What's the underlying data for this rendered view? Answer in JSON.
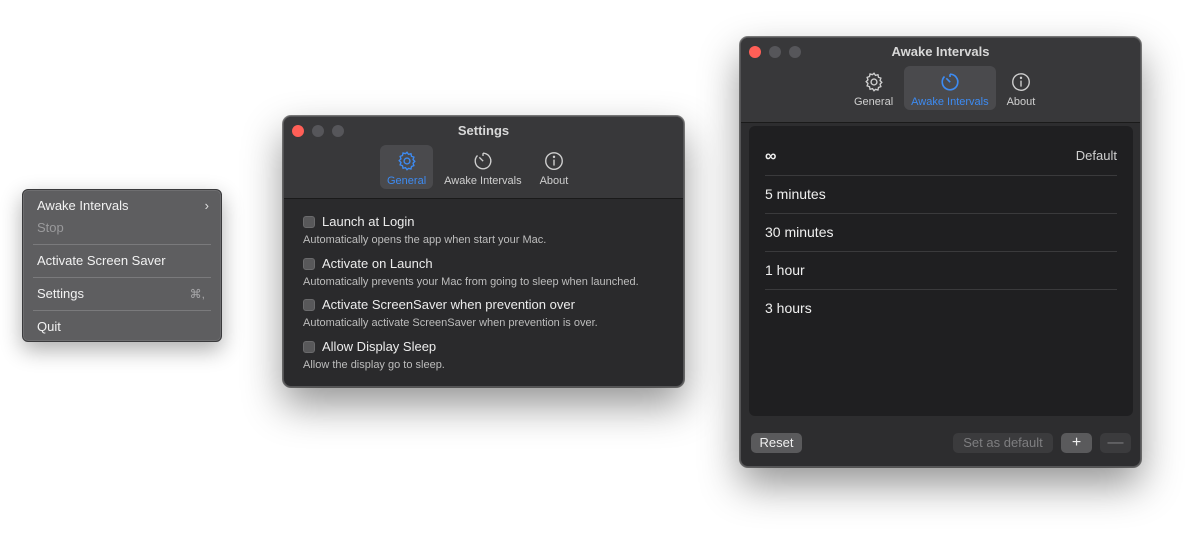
{
  "menu": {
    "items": [
      {
        "label": "Awake Intervals",
        "submenu": true
      },
      {
        "label": "Stop",
        "disabled": true
      },
      {
        "label": "Activate Screen Saver"
      },
      {
        "label": "Settings",
        "shortcut": "⌘,"
      },
      {
        "label": "Quit"
      }
    ]
  },
  "settings_window": {
    "title": "Settings",
    "tabs": [
      {
        "label": "General",
        "icon": "gear-icon",
        "active": true
      },
      {
        "label": "Awake Intervals",
        "icon": "timer-icon"
      },
      {
        "label": "About",
        "icon": "info-icon"
      }
    ],
    "options": [
      {
        "title": "Launch at Login",
        "description": "Automatically opens the app when start your Mac.",
        "checked": false
      },
      {
        "title": "Activate on Launch",
        "description": "Automatically prevents your Mac from going to sleep when launched.",
        "checked": false
      },
      {
        "title": "Activate ScreenSaver when prevention over",
        "description": "Automatically activate ScreenSaver when prevention is over.",
        "checked": false
      },
      {
        "title": "Allow Display Sleep",
        "description": "Allow the display go to sleep.",
        "checked": false
      }
    ]
  },
  "awake_window": {
    "title": "Awake Intervals",
    "tabs": [
      {
        "label": "General",
        "icon": "gear-icon"
      },
      {
        "label": "Awake Intervals",
        "icon": "timer-icon",
        "active": true
      },
      {
        "label": "About",
        "icon": "info-icon"
      }
    ],
    "intervals": [
      {
        "label": "∞",
        "badge": "Default"
      },
      {
        "label": "5 minutes"
      },
      {
        "label": "30 minutes"
      },
      {
        "label": "1 hour"
      },
      {
        "label": "3 hours"
      }
    ],
    "buttons": {
      "reset": "Reset",
      "set_default": "Set as default",
      "add": "+",
      "remove": "—"
    }
  },
  "colors": {
    "accent": "#3d8bf2",
    "close_button": "#ff5f57"
  }
}
